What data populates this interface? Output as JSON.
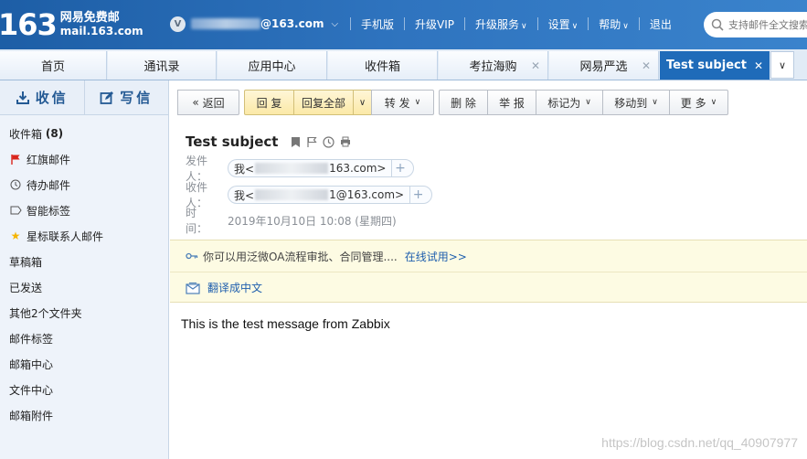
{
  "brand": {
    "logo_number": "163",
    "name": "网易免费邮",
    "domain": "mail.163.com"
  },
  "account": {
    "avatar_letter": "V",
    "email_suffix": "@163.com"
  },
  "top_nav": [
    {
      "label": "手机版",
      "has_dropdown": false
    },
    {
      "label": "升级VIP",
      "has_dropdown": false
    },
    {
      "label": "升级服务",
      "has_dropdown": true
    },
    {
      "label": "设置",
      "has_dropdown": true
    },
    {
      "label": "帮助",
      "has_dropdown": true
    },
    {
      "label": "退出",
      "has_dropdown": false
    }
  ],
  "search": {
    "placeholder": "支持邮件全文搜索"
  },
  "tabs": [
    {
      "label": "首页",
      "closable": false
    },
    {
      "label": "通讯录",
      "closable": false
    },
    {
      "label": "应用中心",
      "closable": false
    },
    {
      "label": "收件箱",
      "closable": false
    },
    {
      "label": "考拉海购",
      "closable": true
    },
    {
      "label": "网易严选",
      "closable": true
    },
    {
      "label": "Test subject",
      "closable": true,
      "active": true
    }
  ],
  "sidebar": {
    "receive_label": "收信",
    "write_label": "写信",
    "folders": [
      {
        "label": "收件箱",
        "count": "(8)",
        "icon": ""
      },
      {
        "label": "红旗邮件",
        "icon": "red-flag-icon"
      },
      {
        "label": "待办邮件",
        "icon": "clock-icon"
      },
      {
        "label": "智能标签",
        "icon": "tag-icon"
      },
      {
        "label": "星标联系人邮件",
        "icon": "star-icon"
      },
      {
        "label": "草稿箱",
        "icon": ""
      },
      {
        "label": "已发送",
        "icon": ""
      },
      {
        "label": "其他2个文件夹",
        "icon": "expand-icon"
      },
      {
        "label": "邮件标签",
        "icon": "expand-icon"
      },
      {
        "label": "邮箱中心",
        "icon": "expand-icon"
      },
      {
        "label": "文件中心",
        "icon": ""
      },
      {
        "label": "邮箱附件",
        "icon": ""
      }
    ]
  },
  "toolbar": {
    "back": "返回",
    "reply": "回 复",
    "reply_all": "回复全部",
    "forward": "转 发",
    "delete": "删 除",
    "report": "举 报",
    "mark_as": "标记为",
    "move_to": "移动到",
    "more": "更 多"
  },
  "mail": {
    "subject": "Test subject",
    "from_label": "发件人：",
    "from_prefix": "我<",
    "from_suffix": "163.com>",
    "to_label": "收件人：",
    "to_prefix": "我<",
    "to_suffix": "1@163.com>",
    "time_label": "时　间：",
    "time_value": "2019年10月10日 10:08 (星期四)",
    "body": "This is the test message from Zabbix"
  },
  "notice": {
    "oa_text": "你可以用泛微OA流程审批、合同管理....",
    "oa_link": "在线试用>>",
    "translate": "翻译成中文"
  },
  "watermark": "https://blog.csdn.net/qq_40907977",
  "colors": {
    "header_blue": "#2f74bf",
    "active_tab": "#1f6bb9",
    "link_blue": "#1f5fae",
    "flag_red": "#d9251c",
    "star_yellow": "#f5b400"
  }
}
